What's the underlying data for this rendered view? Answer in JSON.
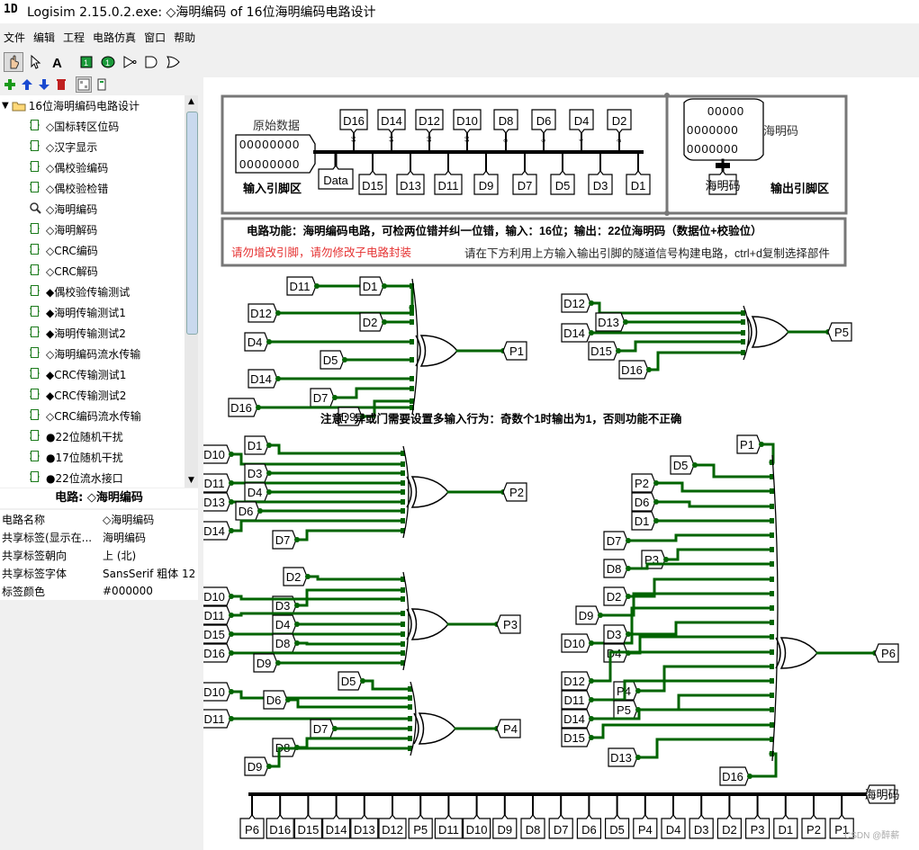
{
  "window": {
    "title": "Logisim 2.15.0.2.exe: ◇海明编码 of 16位海明编码电路设计"
  },
  "menu": [
    "文件",
    "编辑",
    "工程",
    "电路仿真",
    "窗口",
    "帮助"
  ],
  "tree": {
    "root": "16位海明编码电路设计",
    "items": [
      {
        "icon": "subcircuit",
        "label": "◇国标转区位码"
      },
      {
        "icon": "subcircuit",
        "label": "◇汉字显示"
      },
      {
        "icon": "subcircuit",
        "label": "◇偶校验编码"
      },
      {
        "icon": "subcircuit",
        "label": "◇偶校验检错"
      },
      {
        "icon": "magnifier",
        "label": "◇海明编码"
      },
      {
        "icon": "subcircuit",
        "label": "◇海明解码"
      },
      {
        "icon": "subcircuit",
        "label": "◇CRC编码"
      },
      {
        "icon": "subcircuit",
        "label": "◇CRC解码"
      },
      {
        "icon": "subcircuit",
        "label": "◆偶校验传输测试"
      },
      {
        "icon": "subcircuit",
        "label": "◆海明传输测试1"
      },
      {
        "icon": "subcircuit",
        "label": "◆海明传输测试2"
      },
      {
        "icon": "subcircuit",
        "label": "◇海明编码流水传输"
      },
      {
        "icon": "subcircuit",
        "label": "◆CRC传输测试1"
      },
      {
        "icon": "subcircuit",
        "label": "◆CRC传输测试2"
      },
      {
        "icon": "subcircuit",
        "label": "◇CRC编码流水传输"
      },
      {
        "icon": "subcircuit",
        "label": "●22位随机干扰"
      },
      {
        "icon": "subcircuit",
        "label": "●17位随机干扰"
      },
      {
        "icon": "subcircuit",
        "label": "●22位流水接口"
      }
    ]
  },
  "props": {
    "heading": "电路: ◇海明编码",
    "rows": [
      {
        "key": "电路名称",
        "value": "◇海明编码"
      },
      {
        "key": "共享标签(显示在...",
        "value": "海明编码"
      },
      {
        "key": "共享标签朝向",
        "value": "上 (北)"
      },
      {
        "key": "共享标签字体",
        "value": "SansSerif 粗体 12"
      },
      {
        "key": "标签颜色",
        "value": "#000000"
      }
    ]
  },
  "canvas": {
    "input_title": "原始数据",
    "input_bits": "00000000",
    "input_area": "输入引脚区",
    "data_label": "Data",
    "top_tunnels": [
      "D16",
      "D14",
      "D12",
      "D10",
      "D8",
      "D6",
      "D4",
      "D2"
    ],
    "bottom_tunnels": [
      "D15",
      "D13",
      "D11",
      "D9",
      "D7",
      "D5",
      "D3",
      "D1"
    ],
    "output_bits_short": "00000",
    "output_bits_long": "0000000",
    "output_title": "海明码",
    "output_tunnel": "海明码",
    "output_area": "输出引脚区",
    "function_text": "电路功能：海明编码电路，可检两位错并纠一位错，输入：16位；输出：22位海明码（数据位+校验位）",
    "warning": "请勿增改引脚，请勿修改子电路封装",
    "hint": "请在下方利用上方输入输出引脚的隧道信号构建电路，ctrl+d复制选择部件",
    "note": "注意：异或门需要设置多输入行为：奇数个1时输出为1，否则功能不正确",
    "gates": [
      {
        "out": "P1",
        "inputs": [
          "D11",
          "D1",
          "D12",
          "D2",
          "D4",
          "D5",
          "D14",
          "D7",
          "D16",
          "D9"
        ]
      },
      {
        "out": "P5",
        "inputs": [
          "D12",
          "D13",
          "D14",
          "D15",
          "D16"
        ]
      },
      {
        "out": "P2",
        "inputs": [
          "D10",
          "D1",
          "D11",
          "D3",
          "D4",
          "D13",
          "D6",
          "D14",
          "D7"
        ]
      },
      {
        "out": "P3",
        "inputs": [
          "D2",
          "D10",
          "D3",
          "D11",
          "D4",
          "D15",
          "D8",
          "D16",
          "D9"
        ]
      },
      {
        "out": "P4",
        "inputs": [
          "D10",
          "D5",
          "D6",
          "D11",
          "D7",
          "D8",
          "D9"
        ]
      },
      {
        "out": "P6",
        "inputs": [
          "P1",
          "D5",
          "P2",
          "D6",
          "D1",
          "D7",
          "P3",
          "D8",
          "D2",
          "D9",
          "D10",
          "D3",
          "D4",
          "D12",
          "P4",
          "D11",
          "P5",
          "D14",
          "D15",
          "D13",
          "D16"
        ]
      }
    ],
    "bus_tunnels": [
      "P6",
      "D16",
      "D15",
      "D14",
      "D13",
      "D12",
      "P5",
      "D11",
      "D10",
      "D9",
      "D8",
      "D7",
      "D6",
      "D5",
      "P4",
      "D4",
      "D3",
      "D2",
      "P3",
      "D1",
      "P2",
      "P1"
    ],
    "bus_output": "海明码"
  },
  "watermark": "CSDN @醉薪",
  "colors": {
    "wire": "#006400",
    "splitter": "#000000",
    "warning": "#e53030"
  }
}
